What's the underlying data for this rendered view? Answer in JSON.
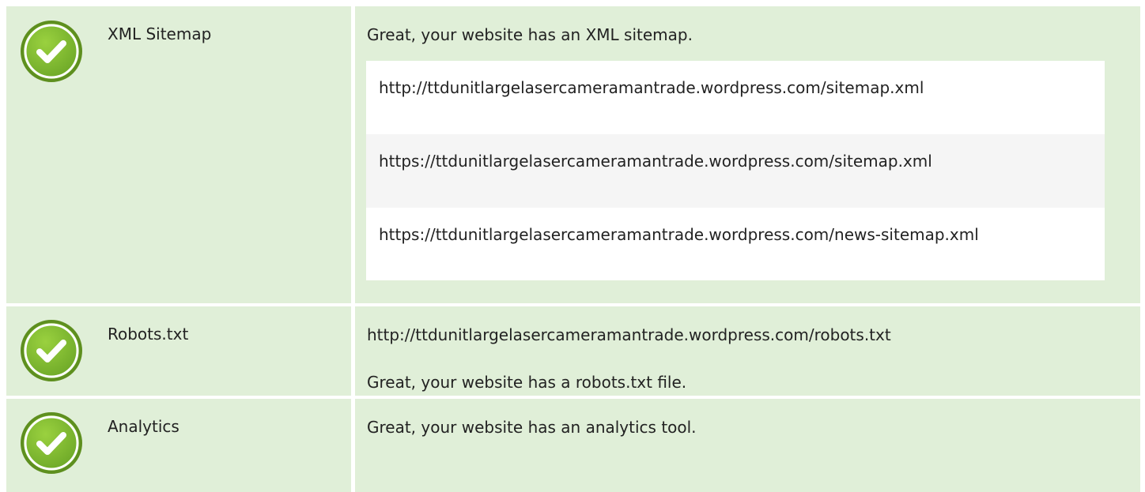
{
  "rows": [
    {
      "status": "pass",
      "label": "XML Sitemap",
      "message": "Great, your website has an XML sitemap.",
      "sitemaps": [
        "http://ttdunitlargelasercameramantrade.wordpress.com/sitemap.xml",
        "https://ttdunitlargelasercameramantrade.wordpress.com/sitemap.xml",
        "https://ttdunitlargelasercameramantrade.wordpress.com/news-sitemap.xml"
      ]
    },
    {
      "status": "pass",
      "label": "Robots.txt",
      "url": "http://ttdunitlargelasercameramantrade.wordpress.com/robots.txt",
      "message": "Great, your website has a robots.txt file."
    },
    {
      "status": "pass",
      "label": "Analytics",
      "message": "Great, your website has an analytics tool."
    }
  ],
  "icon": "check-circle-icon",
  "colors": {
    "row_background": "#e0efd8",
    "check_green": "#7cb82f",
    "check_green_dark": "#5e8f1f"
  }
}
